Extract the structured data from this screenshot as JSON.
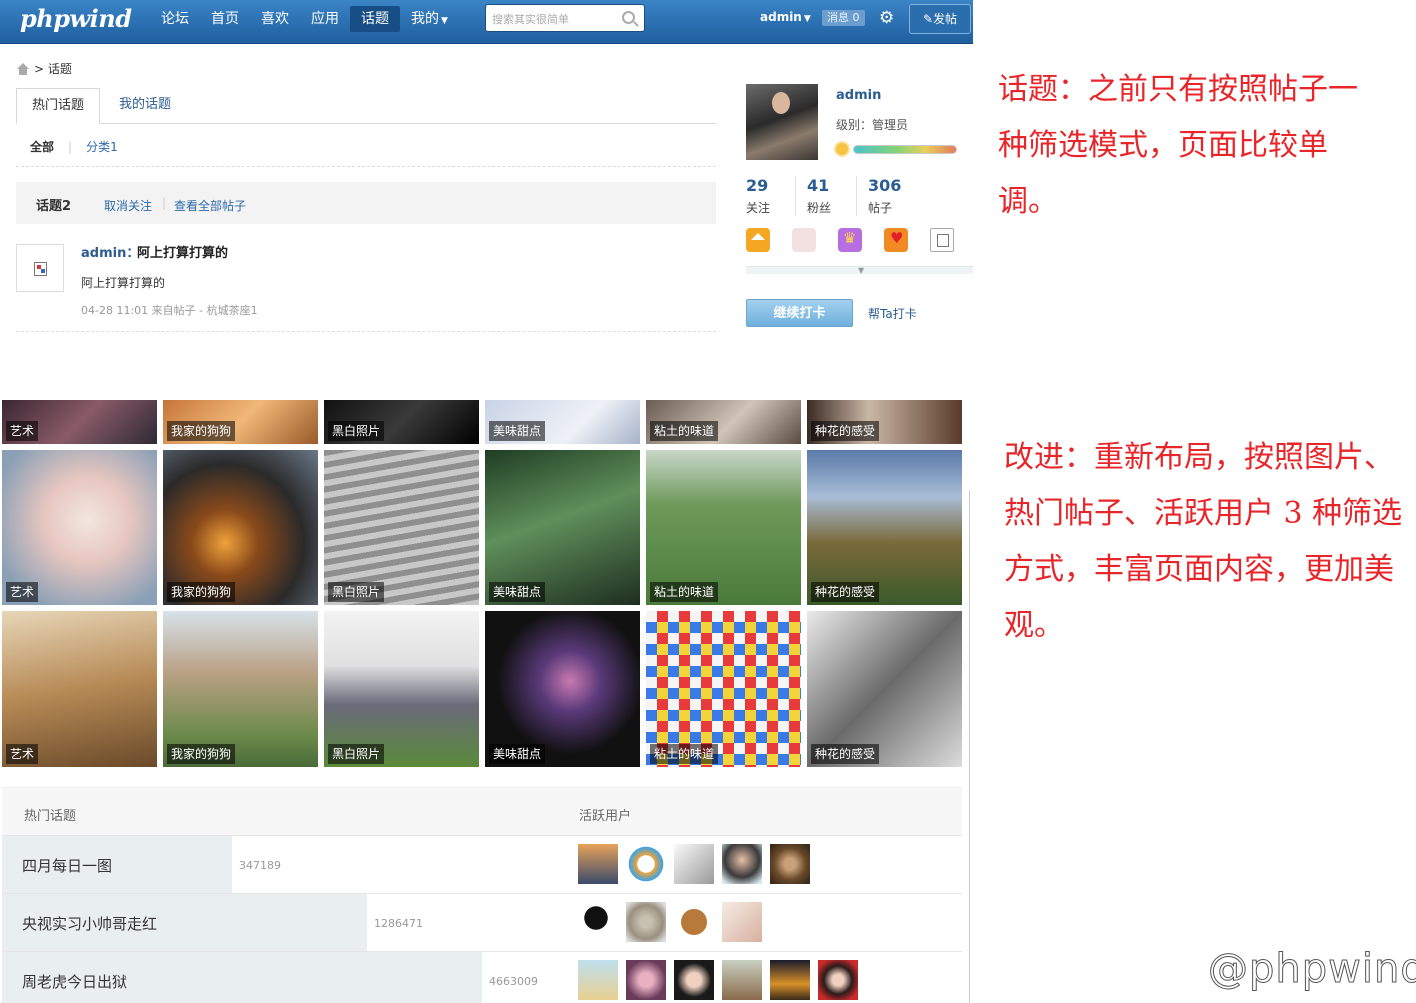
{
  "header": {
    "logo": "phpwind",
    "nav": [
      {
        "label": "论坛",
        "active": false
      },
      {
        "label": "首页",
        "active": false
      },
      {
        "label": "喜欢",
        "active": false
      },
      {
        "label": "应用",
        "active": false
      },
      {
        "label": "话题",
        "active": true
      },
      {
        "label": "我的",
        "active": false,
        "dropdown": true
      }
    ],
    "search_placeholder": "搜索其实很简单",
    "user": "admin",
    "messages": "消息 0",
    "post_button": "发帖",
    "icons": [
      "search-icon",
      "gear-icon",
      "edit-icon",
      "chevron-down-icon"
    ]
  },
  "breadcrumb": {
    "current": "话题"
  },
  "tabs": [
    {
      "label": "热门话题"
    },
    {
      "label": "我的话题"
    }
  ],
  "filters": [
    {
      "label": "全部"
    },
    {
      "label": "分类1"
    }
  ],
  "topic": {
    "title": "话题2",
    "unfollow": "取消关注",
    "view_all": "查看全部帖子"
  },
  "post": {
    "author": "admin：",
    "subject": "阿上打算打算的",
    "body": "阿上打算打算的",
    "meta": "04-28 11:01 来自帖子 - 杭城茶座1"
  },
  "profile": {
    "name": "admin",
    "level": "级别：管理员",
    "level_progress": 0.62,
    "stats": [
      {
        "num": "29",
        "label": "关注"
      },
      {
        "num": "41",
        "label": "粉丝"
      },
      {
        "num": "306",
        "label": "帖子"
      }
    ],
    "medals": [
      "home-icon",
      "picture-icon",
      "crown-icon",
      "heart-icon",
      "broken-image-icon"
    ],
    "punch_button": "继续打卡",
    "help_punch": "帮Ta打卡"
  },
  "annotations": {
    "before": "话题：之前只有按照帖子一种筛选模式，页面比较单调。",
    "after": "改进：重新布局，按照图片、热门帖子、活跃用户 3 种筛选方式，丰富页面内容，更加美观。",
    "watermark": "@phpwind"
  },
  "redesign": {
    "tile_rows": [
      [
        "艺术",
        "我家的狗狗",
        "黑白照片",
        "美味甜点",
        "粘土的味道",
        "种花的感受"
      ],
      [
        "艺术",
        "我家的狗狗",
        "黑白照片",
        "美味甜点",
        "粘土的味道",
        "种花的感受"
      ],
      [
        "艺术",
        "我家的狗狗",
        "黑白照片",
        "美味甜点",
        "粘土的味道",
        "种花的感受"
      ]
    ],
    "hot_topics_title": "热门话题",
    "active_users_title": "活跃用户",
    "hot_topics": [
      {
        "name": "四月每日一图",
        "count": "347189",
        "share": 0.24
      },
      {
        "name": "央视实习小帅哥走红",
        "count": "1286471",
        "share": 0.38
      },
      {
        "name": "周老虎今日出狱",
        "count": "4663009",
        "share": 0.5
      }
    ],
    "colors": {
      "accent": "#2b5d92",
      "header": "#2a6eae",
      "annotation": "#e8262a"
    }
  }
}
